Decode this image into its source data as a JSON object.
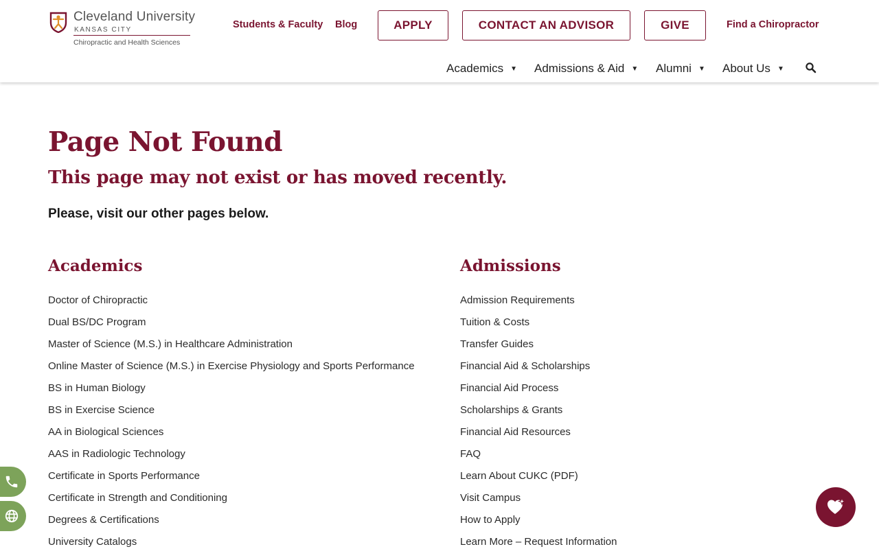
{
  "header": {
    "logo": {
      "name": "Cleveland University",
      "city": "KANSAS CITY",
      "subtitle": "Chiropractic and Health Sciences"
    },
    "utility_links": [
      "Students & Faculty",
      "Blog"
    ],
    "buttons": {
      "apply": "APPLY",
      "contact": "CONTACT AN ADVISOR",
      "give": "GIVE"
    },
    "find_link": "Find a Chiropractor",
    "nav": [
      "Academics",
      "Admissions & Aid",
      "Alumni",
      "About Us"
    ]
  },
  "main": {
    "title": "Page Not Found",
    "subtitle": "This page may not exist or has moved recently.",
    "intro": "Please, visit our other pages below.",
    "academics": {
      "title": "Academics",
      "links": [
        "Doctor of Chiropractic",
        "Dual BS/DC Program",
        "Master of Science (M.S.) in Healthcare Administration",
        "Online Master of Science (M.S.) in Exercise Physiology and Sports Performance",
        "BS in Human Biology",
        "BS in Exercise Science",
        "AA in Biological Sciences",
        "AAS in Radiologic Technology",
        "Certificate in Sports Performance",
        "Certificate in Strength and Conditioning",
        "Degrees & Certifications",
        "University Catalogs"
      ]
    },
    "admissions": {
      "title": "Admissions",
      "links": [
        "Admission Requirements",
        "Tuition & Costs",
        "Transfer Guides",
        "Financial Aid & Scholarships",
        "Financial Aid Process",
        "Scholarships & Grants",
        "Financial Aid Resources",
        "FAQ",
        "Learn About CUKC (PDF)",
        "Visit Campus",
        "How to Apply",
        "Learn More – Request Information"
      ]
    }
  },
  "colors": {
    "brand": "#7a1430",
    "float_green": "#7da35a",
    "text": "#222222"
  },
  "icons": {
    "logo": "logo-mark-icon",
    "search": "search-icon",
    "caret": "caret-down-icon",
    "phone": "phone-icon",
    "globe": "globe-icon",
    "chat": "chat-heart-icon"
  }
}
